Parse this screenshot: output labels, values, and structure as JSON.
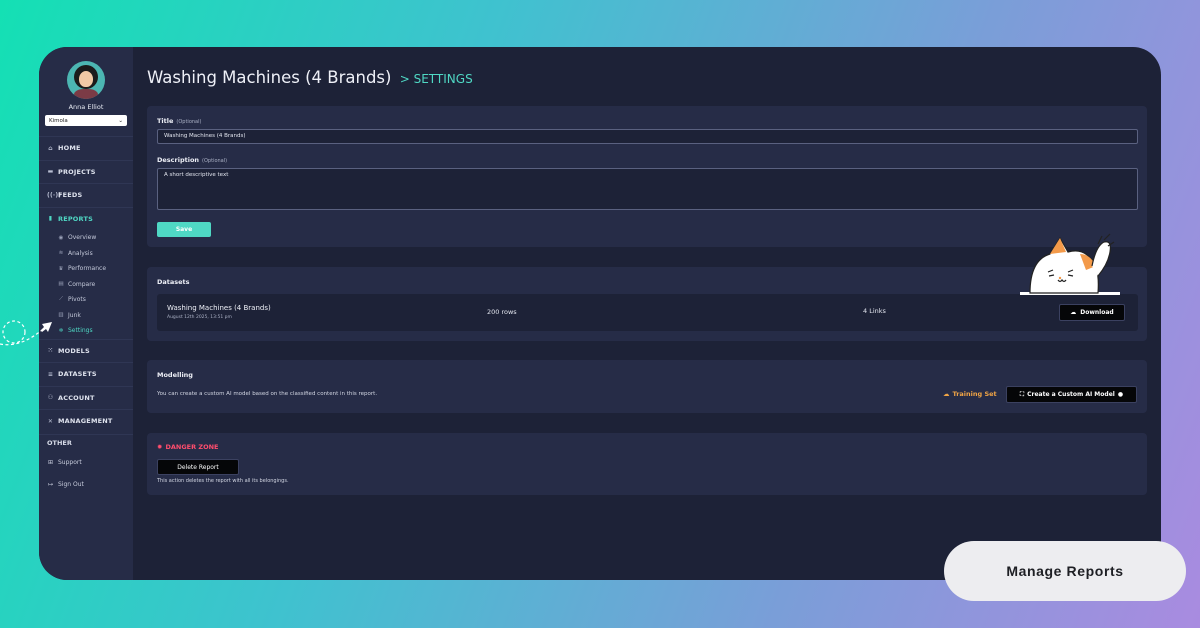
{
  "user": {
    "name": "Anna Elliot",
    "org": "Kimola"
  },
  "nav": {
    "items": [
      {
        "label": "HOME",
        "icon": "home-icon"
      },
      {
        "label": "PROJECTS",
        "icon": "folder-icon"
      },
      {
        "label": "FEEDS",
        "icon": "feeds-icon"
      },
      {
        "label": "REPORTS",
        "icon": "bar-chart-icon"
      }
    ],
    "report_subitems": [
      {
        "label": "Overview",
        "icon": "eye-icon"
      },
      {
        "label": "Analysis",
        "icon": "analysis-icon"
      },
      {
        "label": "Performance",
        "icon": "trophy-icon"
      },
      {
        "label": "Compare",
        "icon": "compare-icon"
      },
      {
        "label": "Pivots",
        "icon": "pivot-icon"
      },
      {
        "label": "Junk",
        "icon": "trash-icon"
      },
      {
        "label": "Settings",
        "icon": "gear-icon"
      }
    ],
    "more_items": [
      {
        "label": "MODELS",
        "icon": "models-icon"
      },
      {
        "label": "DATASETS",
        "icon": "database-icon"
      },
      {
        "label": "ACCOUNT",
        "icon": "account-icon"
      },
      {
        "label": "MANAGEMENT",
        "icon": "management-icon"
      }
    ],
    "other_label": "OTHER",
    "other_items": [
      {
        "label": "Support",
        "icon": "support-icon"
      },
      {
        "label": "Sign Out",
        "icon": "sign-out-icon"
      }
    ]
  },
  "header": {
    "title": "Washing Machines (4 Brands)",
    "separator": ">",
    "crumb": "SETTINGS"
  },
  "settings": {
    "title_label": "Title",
    "title_optional": "(Optional)",
    "title_value": "Washing Machines (4 Brands)",
    "description_label": "Description",
    "description_optional": "(Optional)",
    "description_value": "A short descriptive text",
    "save_label": "Save"
  },
  "datasets": {
    "heading": "Datasets",
    "name": "Washing Machines (4 Brands)",
    "date": "August 12th 2025, 13:51 pm",
    "rows": "200 rows",
    "links": "4 Links",
    "download_label": "Download"
  },
  "modelling": {
    "heading": "Modelling",
    "description": "You can create a custom AI model based on the classified content in this report.",
    "training_label": "Training Set",
    "create_label": "Create a Custom AI Model"
  },
  "danger": {
    "heading": "DANGER ZONE",
    "delete_label": "Delete Report",
    "description": "This action deletes the report with all its belongings."
  },
  "cta": {
    "label": "Manage Reports"
  },
  "colors": {
    "accent": "#4fd8c4",
    "danger": "#ff4d6d",
    "training": "#f1a545",
    "panel": "#262c47",
    "background": "#1d2237"
  }
}
